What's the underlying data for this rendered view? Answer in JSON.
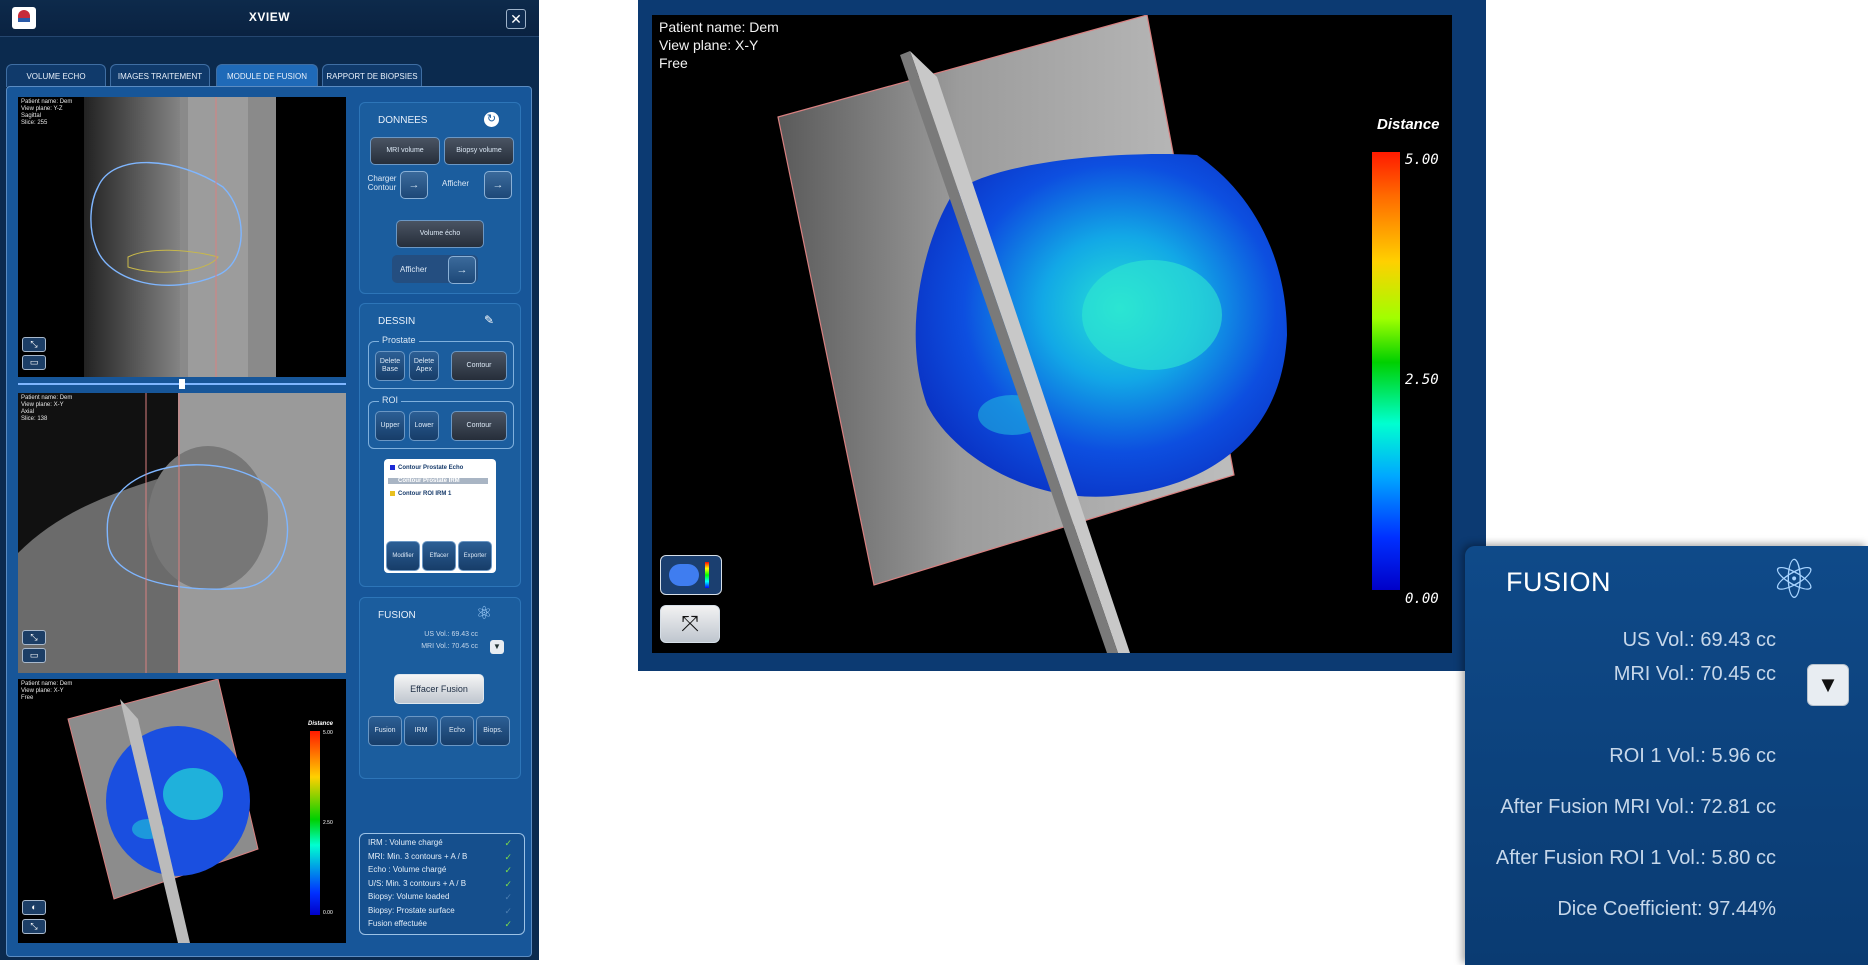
{
  "window": {
    "title": "XVIEW",
    "close_glyph": "✕"
  },
  "tabs": [
    "VOLUME ECHO",
    "IMAGES TRAITEMENT",
    "MODULE DE FUSION",
    "RAPPORT DE BIOPSIES"
  ],
  "viewers": {
    "sagittal": [
      "Patient name: Dem",
      "View plane: Y-Z",
      "Sagittal",
      "Slice: 255"
    ],
    "axial": [
      "Patient name: Dem",
      "View plane: X-Y",
      "Axial",
      "Slice: 138"
    ],
    "free": [
      "Patient name: Dem",
      "View plane: X-Y",
      "Free"
    ]
  },
  "small_colorbar": {
    "title": "Distance",
    "max": "5.00",
    "mid": "2.50",
    "min": "0.00"
  },
  "donnees": {
    "title": "DONNEES",
    "mri_volume": "MRI volume",
    "biopsy_volume": "Biopsy volume",
    "charger_contour": "Charger Contour",
    "afficher_1": "Afficher",
    "volume_echo": "Volume écho",
    "afficher_2": "Afficher",
    "arrow_glyph": "→"
  },
  "dessin": {
    "title": "DESSIN",
    "prostate_label": "Prostate",
    "delete_base": "Delete Base",
    "delete_apex": "Delete Apex",
    "contour_1": "Contour",
    "roi_label": "ROI",
    "upper": "Upper",
    "lower": "Lower",
    "contour_2": "Contour",
    "legend": [
      "Contour Prostate Echo",
      "Contour Prostate IRM",
      "Contour ROI IRM 1"
    ],
    "modifier": "Modifier",
    "effacer": "Effacer",
    "exporter": "Exporter"
  },
  "fusion_panel": {
    "title": "FUSION",
    "us_vol": "US Vol.: 69.43 cc",
    "mri_vol": "MRI Vol.: 70.45 cc",
    "effacer_fusion": "Effacer Fusion",
    "modes": [
      "Fusion",
      "IRM",
      "Echo",
      "Biops."
    ],
    "down_glyph": "▼"
  },
  "status_list": [
    {
      "text": "IRM : Volume chargé",
      "done": true
    },
    {
      "text": "MRI: Min. 3 contours + A / B",
      "done": true
    },
    {
      "text": "Echo : Volume chargé",
      "done": true
    },
    {
      "text": "U/S: Min. 3 contours + A / B",
      "done": true
    },
    {
      "text": "Biopsy: Volume loaded",
      "done": false
    },
    {
      "text": "Biopsy: Prostate surface",
      "done": false
    },
    {
      "text": "Fusion effectuée",
      "done": true
    }
  ],
  "big_view": {
    "overlay": [
      "Patient name: Dem",
      "View plane: X-Y",
      "Free"
    ],
    "colorbar": {
      "title": "Distance",
      "max": "5.00",
      "mid": "2.50",
      "min": "0.00"
    }
  },
  "fusion_zoom": {
    "title": "FUSION",
    "us_vol": "US Vol.: 69.43 cc",
    "mri_vol": "MRI Vol.: 70.45 cc",
    "roi_vol": "ROI 1 Vol.: 5.96 cc",
    "after_mri": "After Fusion MRI Vol.: 72.81 cc",
    "after_roi": "After Fusion ROI 1 Vol.: 5.80 cc",
    "dice": "Dice Coefficient: 97.44%",
    "down_glyph": "▼"
  },
  "icons": [
    "app-logo",
    "close-icon",
    "snapshot-icon",
    "expand-icon",
    "reload-icon",
    "brush-icon",
    "atom-icon",
    "checkmark-icon",
    "chevron-down-icon",
    "colormap-icon",
    "compress-icon"
  ],
  "colors": {
    "window_bg": "#0b2a4e",
    "panel_bg": "#175699",
    "check_green": "#7ee048",
    "frame_blue": "#0c3a72"
  }
}
